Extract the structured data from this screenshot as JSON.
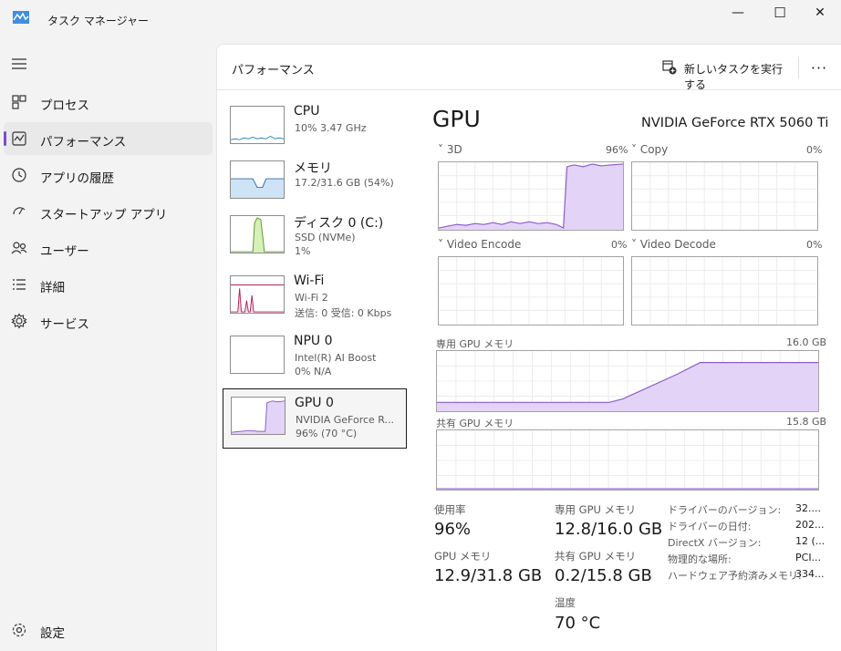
{
  "window": {
    "title": "タスク マネージャー",
    "minimize": "—",
    "maximize": "☐",
    "close": "✕"
  },
  "sidebar": {
    "items": [
      {
        "label": "プロセス",
        "icon": "processes-icon"
      },
      {
        "label": "パフォーマンス",
        "icon": "performance-icon",
        "active": true
      },
      {
        "label": "アプリの履歴",
        "icon": "app-history-icon"
      },
      {
        "label": "スタートアップ アプリ",
        "icon": "startup-icon"
      },
      {
        "label": "ユーザー",
        "icon": "users-icon"
      },
      {
        "label": "詳細",
        "icon": "details-icon"
      },
      {
        "label": "サービス",
        "icon": "services-icon"
      }
    ],
    "settings_label": "設定"
  },
  "header": {
    "title": "パフォーマンス",
    "new_task_label": "新しいタスクを実行する",
    "more_label": "···"
  },
  "devices": [
    {
      "name": "CPU",
      "line1": "10%  3.47 GHz",
      "line2": ""
    },
    {
      "name": "メモリ",
      "line1": "17.2/31.6 GB (54%)",
      "line2": ""
    },
    {
      "name": "ディスク 0 (C:)",
      "line1": "SSD (NVMe)",
      "line2": "1%"
    },
    {
      "name": "Wi-Fi",
      "line1": "Wi-Fi 2",
      "line2": "送信: 0 受信: 0 Kbps"
    },
    {
      "name": "NPU 0",
      "line1": "Intel(R) AI Boost",
      "line2": "0%  N/A"
    },
    {
      "name": "GPU 0",
      "line1": "NVIDIA GeForce R...",
      "line2": "96% (70 °C)",
      "active": true
    }
  ],
  "detail": {
    "heading": "GPU",
    "model": "NVIDIA GeForce RTX 5060 Ti",
    "engines": [
      {
        "label": "3D",
        "pct": "96%"
      },
      {
        "label": "Copy",
        "pct": "0%"
      },
      {
        "label": "Video Encode",
        "pct": "0%"
      },
      {
        "label": "Video Decode",
        "pct": "0%"
      }
    ],
    "dedicated_label": "専用 GPU メモリ",
    "dedicated_max": "16.0 GB",
    "shared_label": "共有 GPU メモリ",
    "shared_max": "15.8 GB",
    "stats": {
      "utilization_label": "使用率",
      "utilization_value": "96%",
      "dedicated_label": "専用 GPU メモリ",
      "dedicated_value": "12.8/16.0 GB",
      "gpu_memory_label": "GPU メモリ",
      "gpu_memory_value": "12.9/31.8 GB",
      "shared_label": "共有 GPU メモリ",
      "shared_value": "0.2/15.8 GB",
      "temp_label": "温度",
      "temp_value": "70 °C"
    },
    "info": [
      {
        "label": "ドライバーのバージョン:",
        "value": "32...."
      },
      {
        "label": "ドライバーの日付:",
        "value": "202..."
      },
      {
        "label": "DirectX バージョン:",
        "value": "12 (..."
      },
      {
        "label": "物理的な場所:",
        "value": "PCI..."
      },
      {
        "label": "ハードウェア予約済みメモリ:",
        "value": "334..."
      }
    ]
  },
  "colors": {
    "accent": "#7d4ec6",
    "gpu_fill": "#e3d4f7",
    "gpu_line": "#8a5cc9",
    "cpu_line": "#2a8ab3",
    "mem_fill": "#cfe3f7",
    "mem_line": "#2a6cb3",
    "disk_fill": "#d7f0b8",
    "disk_line": "#5a9a2a",
    "wifi_line": "#b4245b"
  }
}
